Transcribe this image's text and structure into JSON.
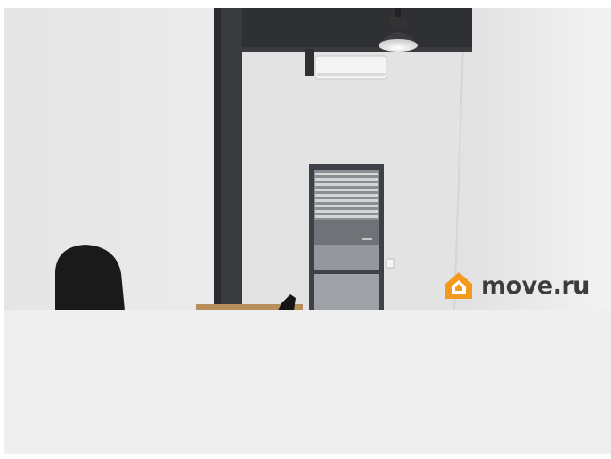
{
  "photo": {
    "scene": "office-interior",
    "watermark_text": "move.ru",
    "watermark_icon": "house-logo-icon",
    "colors": {
      "wall_left": "#e9e8e8",
      "wall_back": "#e4e3e3",
      "wall_right": "#eeeeee",
      "beam": "#2f3033",
      "door_frame": "#3e4147",
      "chair": "#1a1a1a",
      "logo_orange": "#f39a1e"
    }
  },
  "placeholder": {
    "color": "#efefef"
  }
}
